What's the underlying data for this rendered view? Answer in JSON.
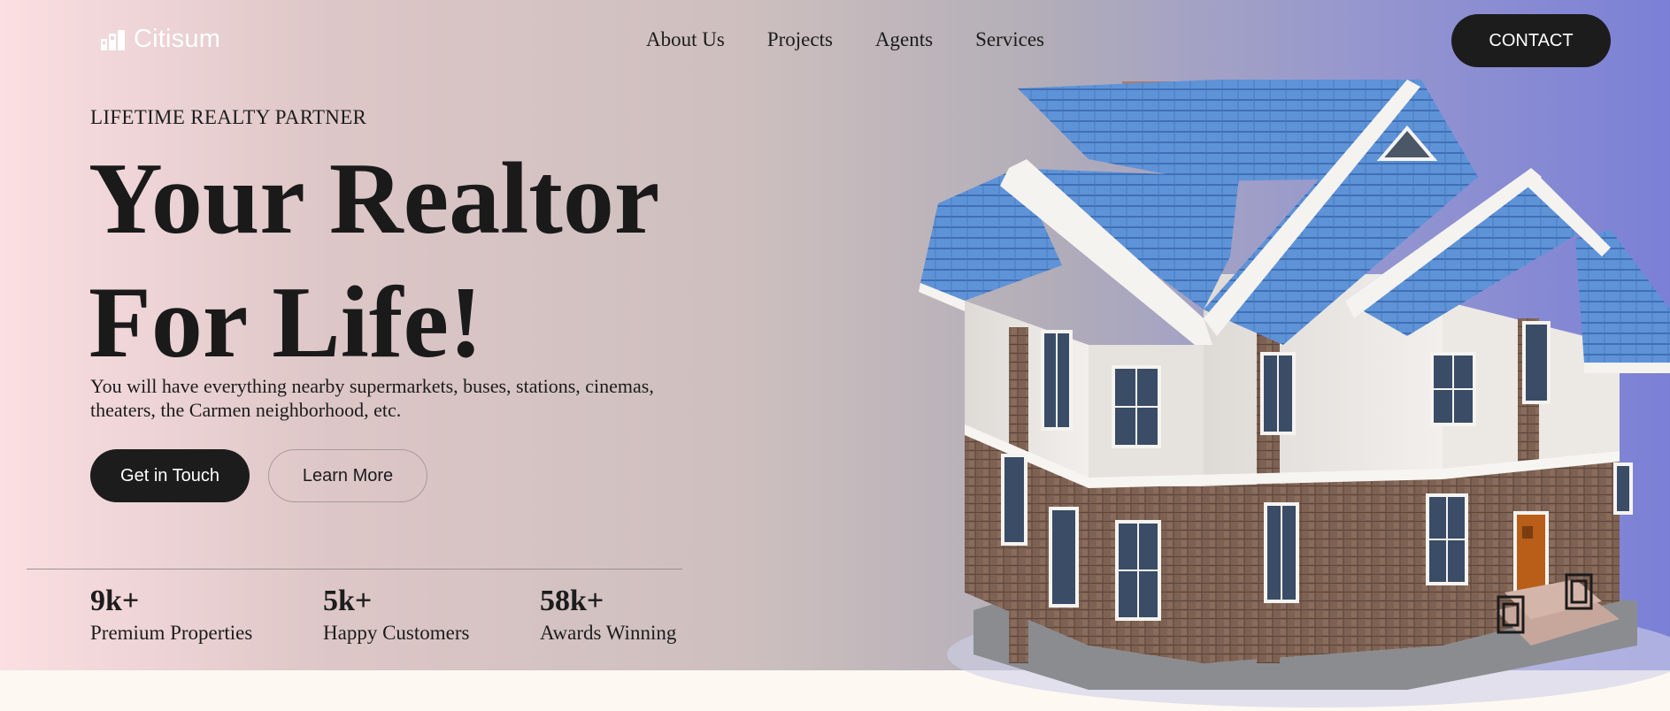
{
  "brand": {
    "name": "Citisum",
    "icon": "buildings-icon"
  },
  "nav": {
    "items": [
      {
        "label": "About Us"
      },
      {
        "label": "Projects"
      },
      {
        "label": "Agents"
      },
      {
        "label": "Services"
      }
    ],
    "contact_label": "CONTACT"
  },
  "hero": {
    "eyebrow": "LIFETIME REALTY PARTNER",
    "headline_line1": "Your Realtor",
    "headline_line2": "For Life!",
    "description": "You will have everything nearby supermarkets, buses, stations, cinemas, theaters, the Carmen neighborhood, etc.",
    "primary_cta": "Get in Touch",
    "secondary_cta": "Learn More"
  },
  "stats": [
    {
      "value": "9k+",
      "label": "Premium Properties"
    },
    {
      "value": "5k+",
      "label": "Happy Customers"
    },
    {
      "value": "58k+",
      "label": "Awards Winning"
    }
  ],
  "colors": {
    "gradient_start": "#fbdfe2",
    "gradient_end": "#7b80d6",
    "button_dark": "#1c1c1c",
    "roof_blue": "#5b8fd6",
    "page_bottom": "#fdf8f2"
  }
}
